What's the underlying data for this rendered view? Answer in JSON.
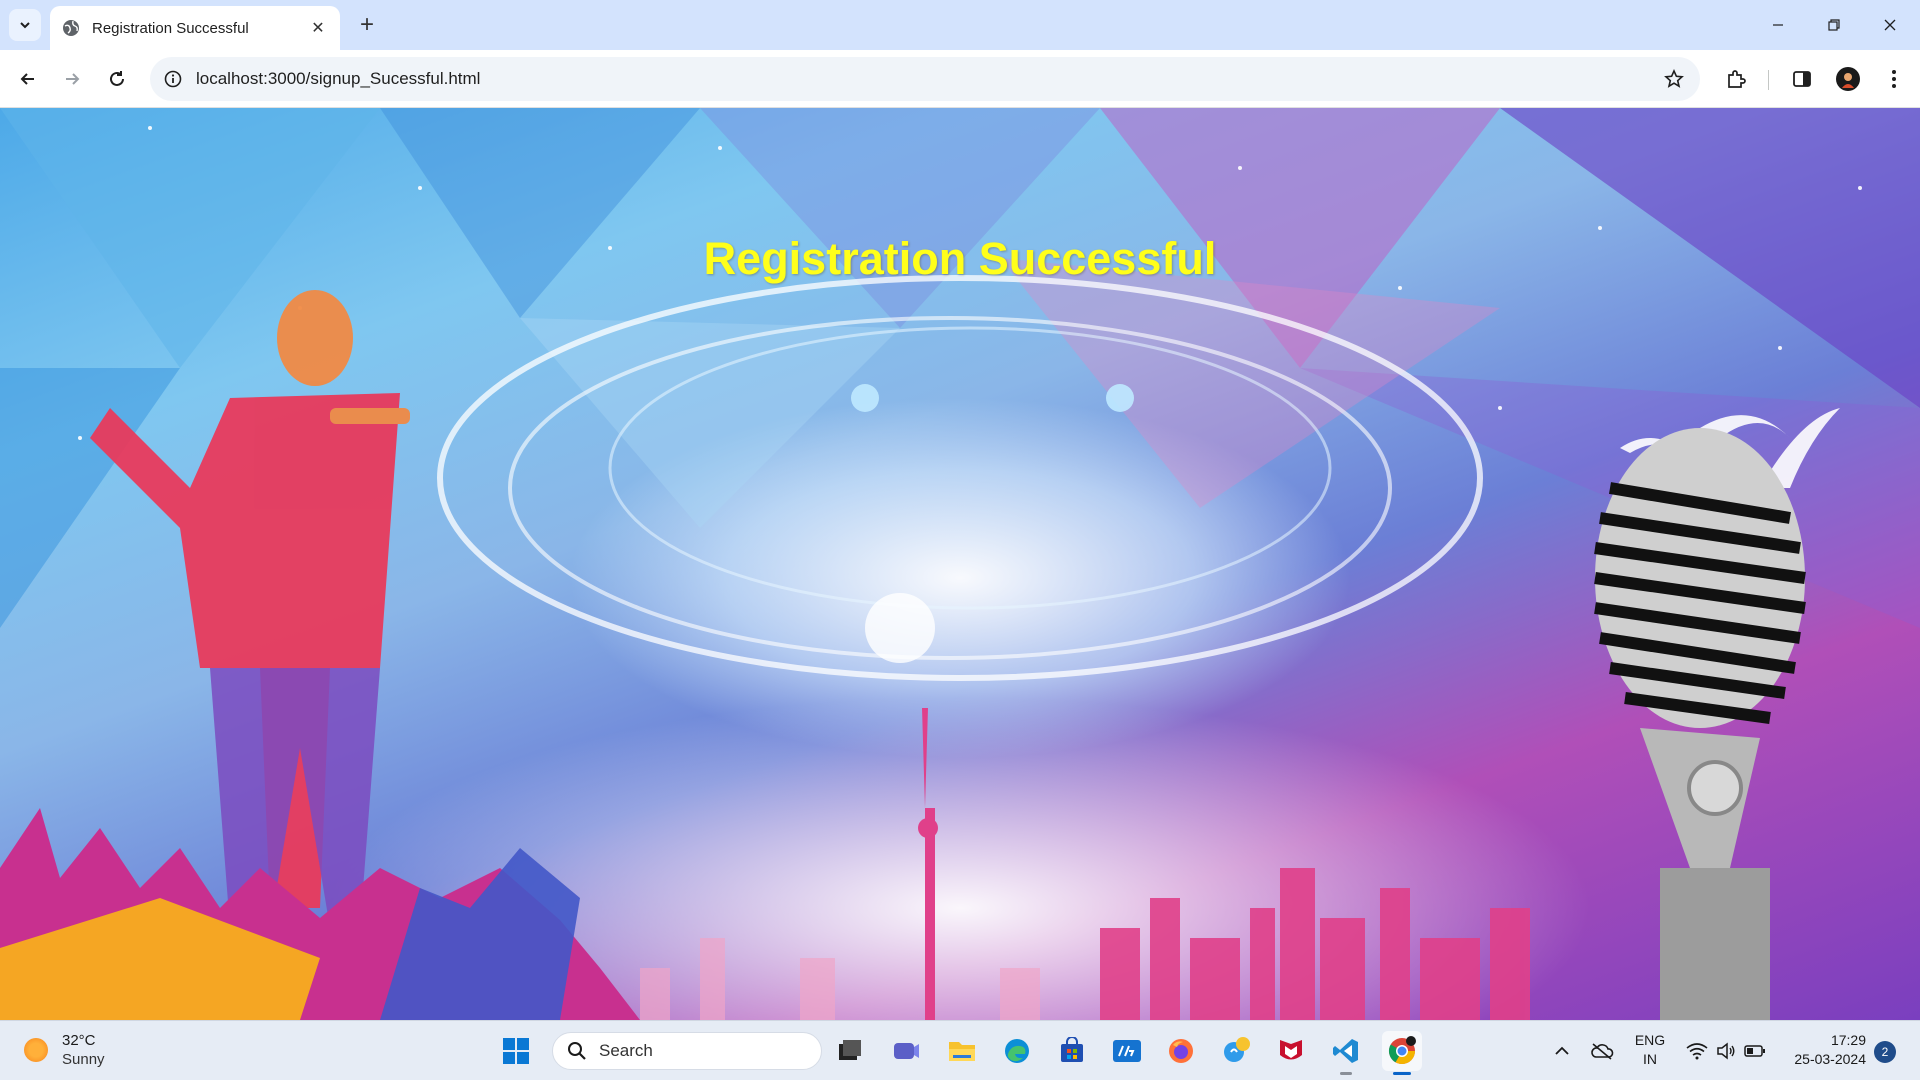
{
  "browser": {
    "tab": {
      "title": "Registration Successful",
      "icon": "globe-icon"
    },
    "address_bar": {
      "url": "localhost:3000/signup_Sucessful.html",
      "icon": "info-icon"
    }
  },
  "page": {
    "heading": "Registration Successful",
    "heading_color": "#ffff1a",
    "background_description_colors": [
      "#4da9e8",
      "#b04fb8",
      "#ffffff"
    ]
  },
  "taskbar": {
    "weather": {
      "temperature": "32°C",
      "condition": "Sunny",
      "icon": "sun-icon"
    },
    "search": {
      "label": "Search",
      "icon": "search-icon"
    },
    "apps": [
      "windows-start-icon",
      "task-view-icon",
      "teams-icon",
      "file-explorer-icon",
      "edge-icon",
      "store-icon",
      "myhp-icon",
      "firefox-icon",
      "chat-icon",
      "mcafee-icon",
      "vscode-icon",
      "chrome-icon"
    ],
    "tray": {
      "language_line1": "ENG",
      "language_line2": "IN",
      "time": "17:29",
      "date": "25-03-2024",
      "notification_count": "2"
    }
  }
}
